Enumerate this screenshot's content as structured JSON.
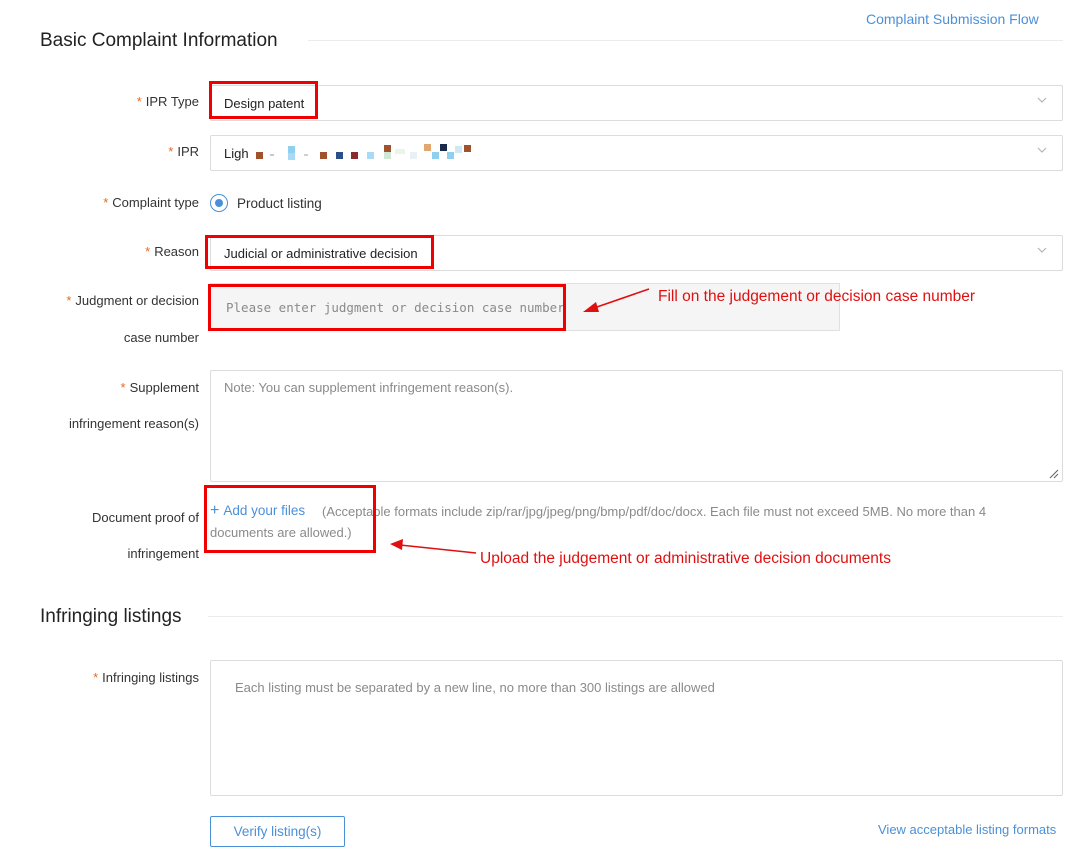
{
  "header": {
    "flow_link": "Complaint Submission Flow"
  },
  "sections": {
    "basic_title": "Basic Complaint Information",
    "infringing_title": "Infringing listings"
  },
  "fields": {
    "required_mark": "*",
    "ipr_type": {
      "label": "IPR Type",
      "value": "Design patent"
    },
    "ipr": {
      "label": "IPR",
      "value": "Ligh"
    },
    "complaint_type": {
      "label": "Complaint type",
      "option": "Product listing",
      "selected": true
    },
    "reason": {
      "label": "Reason",
      "value": "Judicial or administrative decision"
    },
    "case_number": {
      "label_line1": "Judgment or decision",
      "label_line2": "case number",
      "placeholder": "Please enter judgment or decision case number"
    },
    "supplement": {
      "label_line1": "Supplement",
      "label_line2": "infringement reason(s)",
      "placeholder": "Note: You can supplement infringement reason(s)."
    },
    "proof": {
      "label_line1": "Document proof of",
      "label_line2": "infringement",
      "add_files": "Add your files",
      "hint": "(Acceptable formats include zip/rar/jpg/jpeg/png/bmp/pdf/doc/docx. Each file must not exceed 5MB. No more than 4 documents are allowed.)"
    },
    "listings": {
      "label": "Infringing listings",
      "placeholder": "Each listing must be separated by a new line, no more than 300 listings are allowed"
    }
  },
  "actions": {
    "verify_button": "Verify listing(s)",
    "formats_link": "View acceptable listing formats"
  },
  "annotations": {
    "case_number_note": "Fill on the judgement or decision case number",
    "upload_note": "Upload the judgement or administrative decision documents"
  },
  "colors": {
    "accent": "#4a90d9",
    "required": "#e56a1e",
    "annotation": "#e01010"
  }
}
